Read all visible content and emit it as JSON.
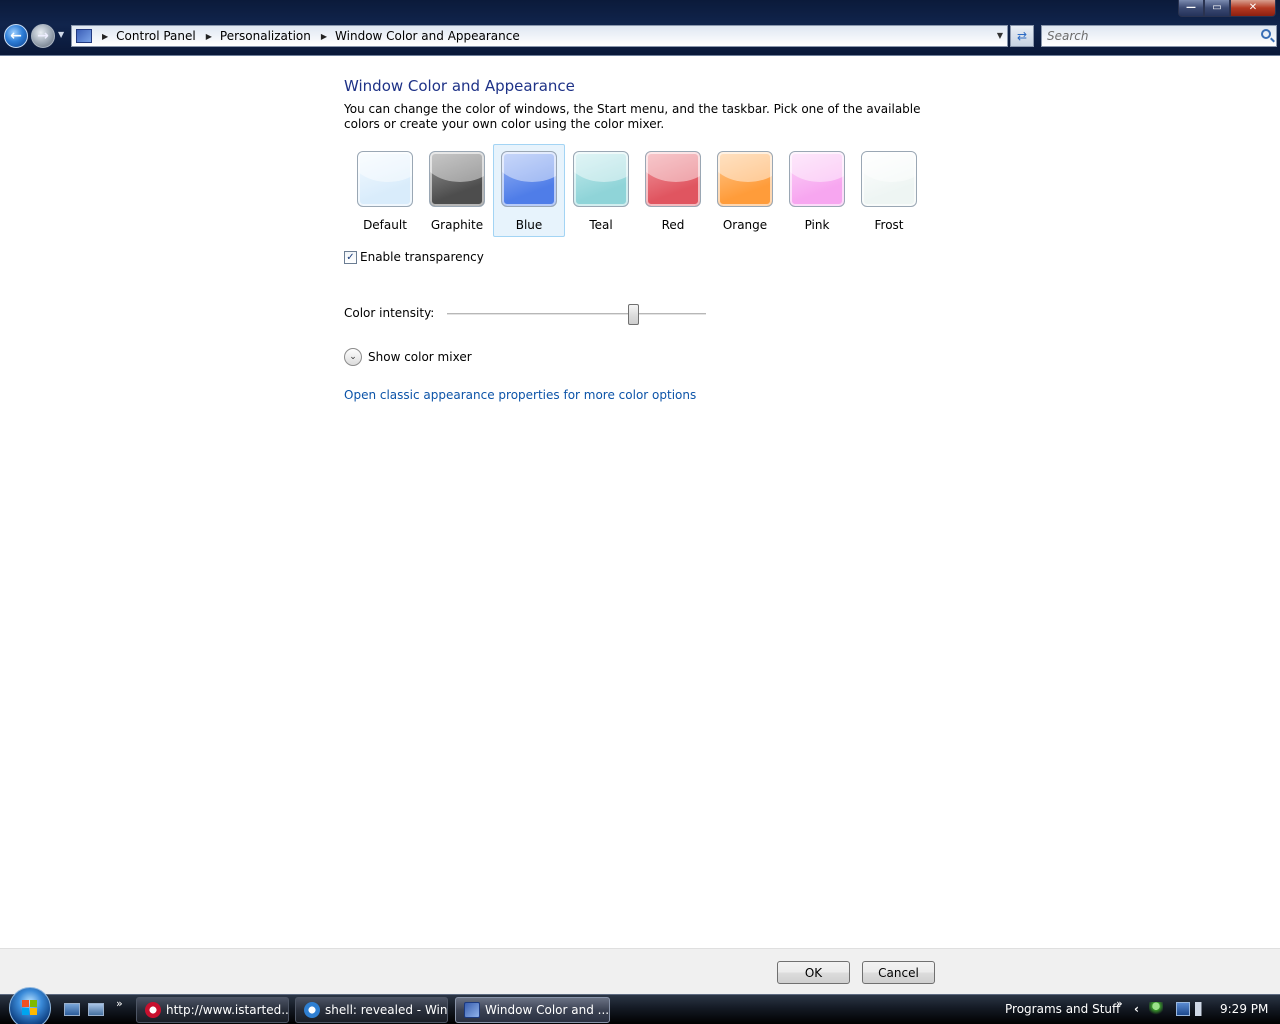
{
  "window": {
    "caption_buttons": {
      "minimize": "—",
      "maximize": "▭",
      "close": "✕"
    }
  },
  "nav": {
    "back_glyph": "←",
    "forward_glyph": "→",
    "dropdown_glyph": "▼"
  },
  "address": {
    "breadcrumbs": [
      "Control Panel",
      "Personalization",
      "Window Color and Appearance"
    ],
    "separator": "▶",
    "dropdown_glyph": "▼",
    "refresh_glyph": "⇄"
  },
  "search": {
    "placeholder": "Search"
  },
  "main": {
    "title": "Window Color and Appearance",
    "description": "You can change the color of windows, the Start menu, and the taskbar. Pick one of the available colors or create your own color using the color mixer.",
    "swatches": [
      {
        "label": "Default",
        "color": "#d9ecfb",
        "color2": "#f4faff"
      },
      {
        "label": "Graphite",
        "color": "#4d4d4d",
        "color2": "#9a9a9a"
      },
      {
        "label": "Blue",
        "color": "#4f7de8",
        "color2": "#9ab6f5"
      },
      {
        "label": "Teal",
        "color": "#8fd4d8",
        "color2": "#c6ecee"
      },
      {
        "label": "Red",
        "color": "#e05560",
        "color2": "#f19aa1"
      },
      {
        "label": "Orange",
        "color": "#ff9c3a",
        "color2": "#ffc98f"
      },
      {
        "label": "Pink",
        "color": "#f7a6f0",
        "color2": "#fcd6f8"
      },
      {
        "label": "Frost",
        "color": "#eef5f3",
        "color2": "#ffffff"
      }
    ],
    "selected_swatch": "Blue",
    "transparency": {
      "label": "Enable transparency",
      "checked": true,
      "check_glyph": "✓"
    },
    "intensity": {
      "label": "Color intensity:",
      "value": 0.72
    },
    "color_mixer": {
      "label": "Show color mixer",
      "toggle_glyph": "⌄"
    },
    "classic_link": "Open classic appearance properties for more color options"
  },
  "buttons": {
    "ok": "OK",
    "cancel": "Cancel"
  },
  "taskbar": {
    "quicklaunch_more": "»",
    "tasks": [
      {
        "label": "http://www.istarted...",
        "icon_color": "#c8102e",
        "active": false
      },
      {
        "label": "shell: revealed - Win...",
        "icon_color": "#2f7fd1",
        "active": false
      },
      {
        "label": "Window Color and ...",
        "icon_color": "#3a5fb0",
        "active": true
      }
    ],
    "toolbar_label": "Programs and Stuff",
    "toolbar_more": "»",
    "tray_expand": "‹",
    "clock": "9:29 PM"
  },
  "colors": {
    "title_blue": "#1e3287",
    "link_blue": "#0b53a8",
    "selection_bg": "#e7f3fc",
    "selection_border": "#a3d4f4"
  }
}
